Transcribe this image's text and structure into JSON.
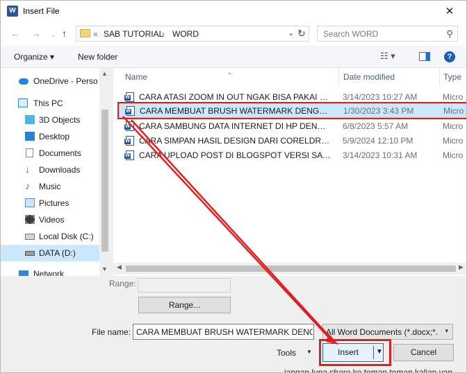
{
  "window": {
    "title": "Insert File",
    "app_icon": "word-icon",
    "close_glyph": "✕"
  },
  "address": {
    "back_glyph": "←",
    "forward_glyph": "→",
    "up_glyph": "↑",
    "prefix": "«",
    "crumbs": [
      "SAB TUTORIAL",
      "WORD"
    ],
    "separator": "›",
    "search_placeholder": "Search WORD"
  },
  "toolbar": {
    "organize": "Organize",
    "new_folder": "New folder",
    "help": "?"
  },
  "nav": {
    "items": [
      {
        "label": "OneDrive - Perso",
        "icon": "cloud-icon"
      },
      {
        "label": "This PC",
        "icon": "computer-icon"
      },
      {
        "label": "3D Objects",
        "icon": "cube-icon"
      },
      {
        "label": "Desktop",
        "icon": "desktop-icon"
      },
      {
        "label": "Documents",
        "icon": "document-icon"
      },
      {
        "label": "Downloads",
        "icon": "download-icon"
      },
      {
        "label": "Music",
        "icon": "music-icon"
      },
      {
        "label": "Pictures",
        "icon": "picture-icon"
      },
      {
        "label": "Videos",
        "icon": "video-icon"
      },
      {
        "label": "Local Disk (C:)",
        "icon": "drive-icon"
      },
      {
        "label": "DATA (D:)",
        "icon": "drive-icon"
      },
      {
        "label": "Network",
        "icon": "network-icon"
      }
    ]
  },
  "files": {
    "columns": {
      "name": "Name",
      "date": "Date modified",
      "type": "Type"
    },
    "rows": [
      {
        "name": "CARA ATASI ZOOM IN OUT NGAK BISA PAKAI SCR...",
        "date": "3/14/2023 10:27 AM",
        "type": "Micro"
      },
      {
        "name": "CARA MEMBUAT BRUSH WATERMARK DENGAN N...",
        "date": "1/30/2023 3:43 PM",
        "type": "Micro"
      },
      {
        "name": "CARA SAMBUNG DATA INTERNET DI HP DENGAN ...",
        "date": "6/8/2023 5:57 AM",
        "type": "Micro"
      },
      {
        "name": "CARA SIMPAN HASIL DESIGN DARI CORELDRAW X...",
        "date": "5/9/2024 12:10 PM",
        "type": "Micro"
      },
      {
        "name": "CARA UPLOAD POST DI BLOGSPOT VERSI SA BELAJ...",
        "date": "3/14/2023 10:31 AM",
        "type": "Micro"
      }
    ],
    "selected_index": 1
  },
  "bottom": {
    "range_label": "Range:",
    "range_button": "Range...",
    "filename_label": "File name:",
    "filename_value": "CARA MEMBUAT BRUSH WATERMARK DENG",
    "filter_value": "All Word Documents (*.docx;*.d",
    "tools": "Tools",
    "insert": "Insert",
    "cancel": "Cancel"
  },
  "background": {
    "peek_text": "jangan lupa share ke teman teman kalian yan"
  },
  "colors": {
    "highlight_red": "#e02020",
    "selection_blue": "#cce8ff",
    "accent_blue": "#0078d7"
  }
}
